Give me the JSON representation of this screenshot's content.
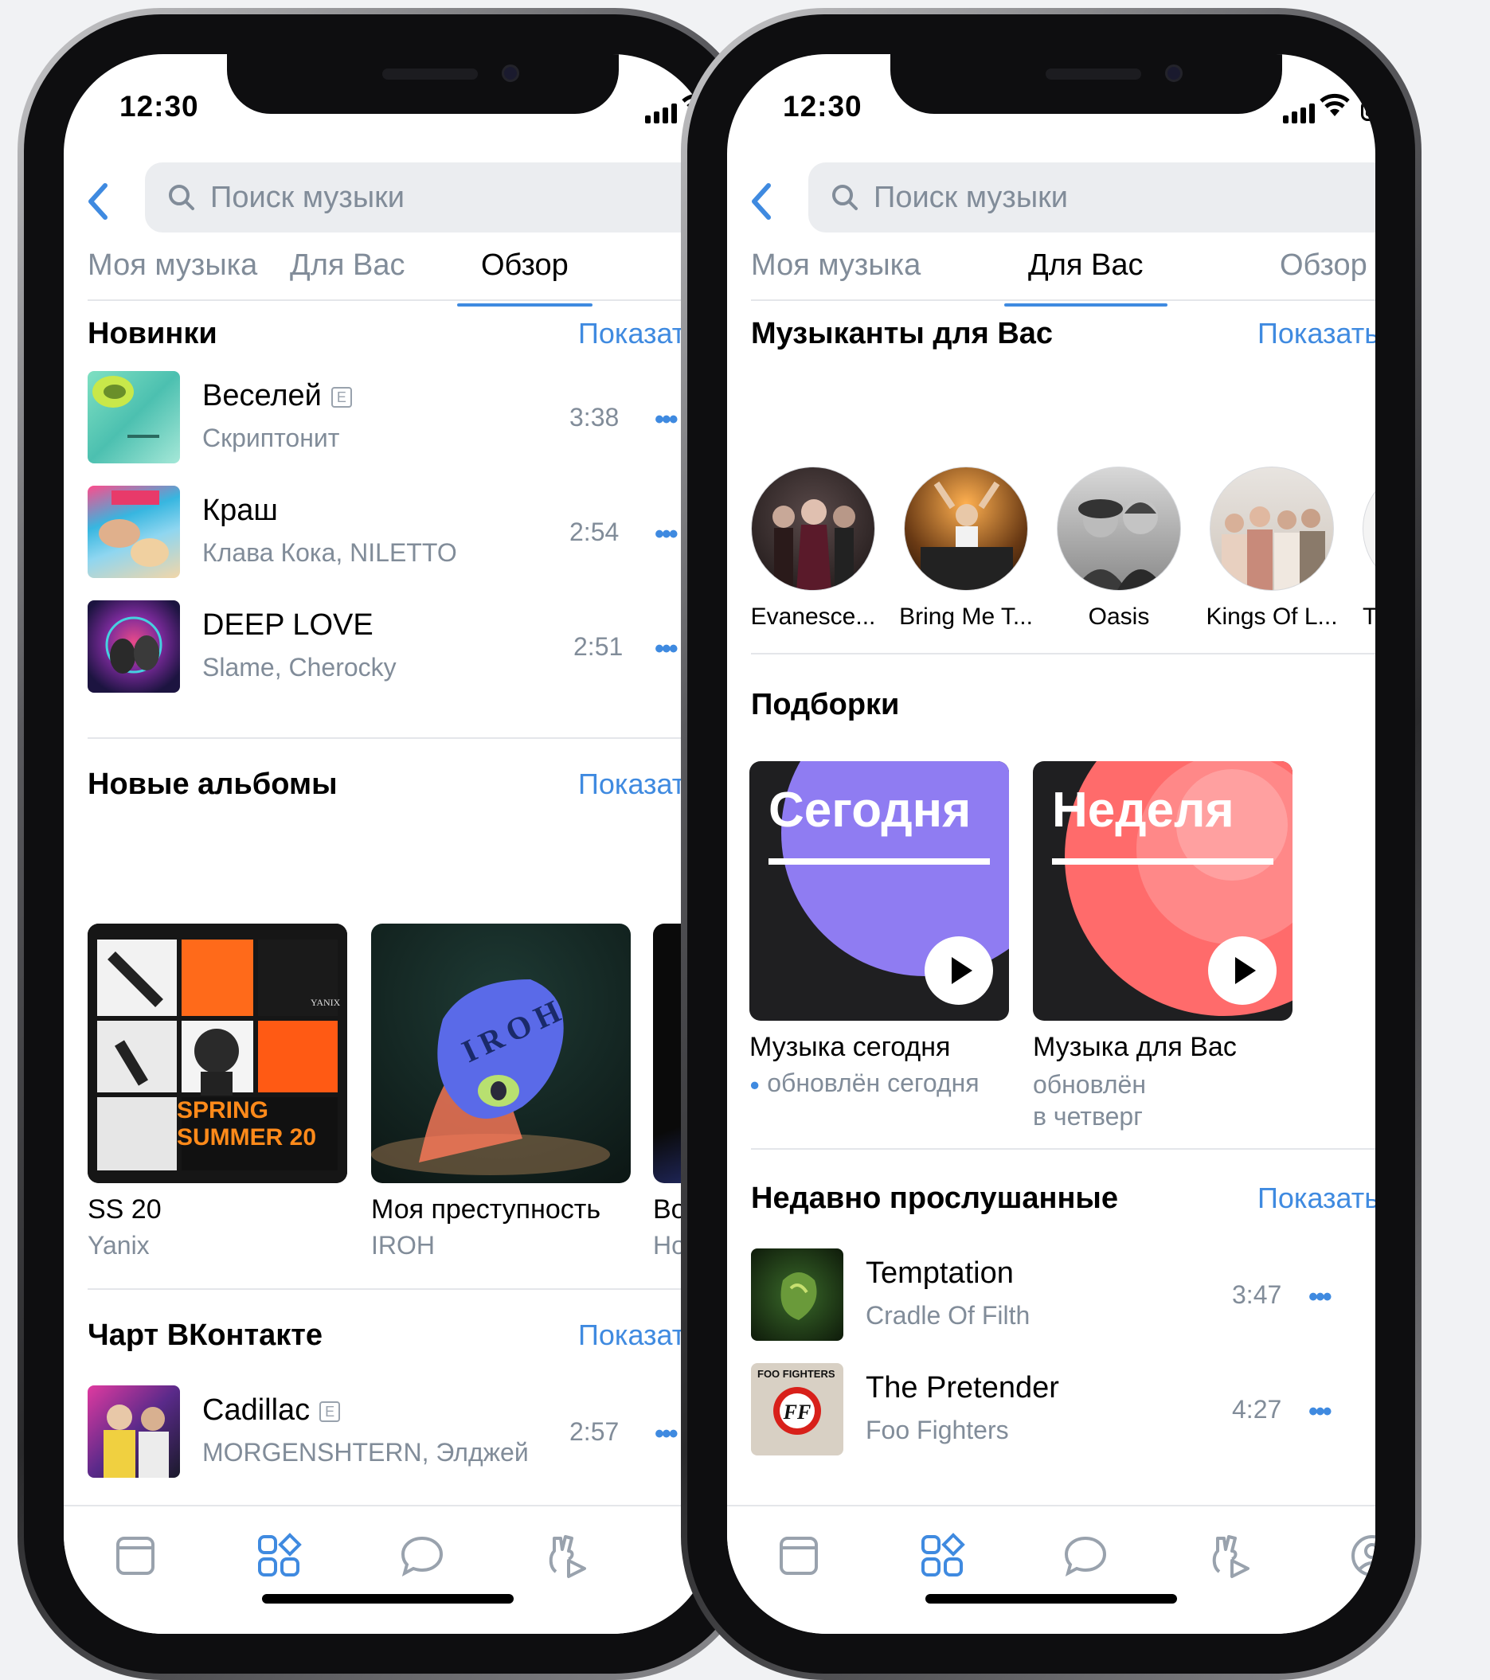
{
  "status_time": "12:30",
  "search_placeholder": "Поиск музыки",
  "tabs": {
    "my_music": "Моя музыка",
    "for_you": "Для Вас",
    "browse": "Обзор"
  },
  "left_screen": {
    "active_tab": "browse",
    "sections": {
      "new_tracks": {
        "title": "Новинки",
        "show_all": "Показать все"
      },
      "new_albums": {
        "title": "Новые альбомы",
        "show_all": "Показать все"
      },
      "chart": {
        "title": "Чарт ВКонтакте",
        "show_all": "Показать все"
      }
    },
    "new_tracks": [
      {
        "title": "Веселей",
        "artist": "Скриптонит",
        "duration": "3:38",
        "explicit": true
      },
      {
        "title": "Краш",
        "artist": "Клава Кока, NILETTO",
        "duration": "2:54",
        "explicit": false
      },
      {
        "title": "DEEP LOVE",
        "artist": "Slame, Cherocky",
        "duration": "2:51",
        "explicit": false
      }
    ],
    "albums": [
      {
        "title": "SS 20",
        "artist": "Yanix",
        "cover_text_1": "SPRING",
        "cover_text_2": "SUMMER 20",
        "cover_text_3": "YANIX"
      },
      {
        "title": "Моя преступность",
        "artist": "IROH",
        "cover_text": "IROH"
      },
      {
        "title": "Во",
        "artist": "Но"
      }
    ],
    "chart_tracks": [
      {
        "title": "Cadillac",
        "artist": "MORGENSHTERN, Элджей",
        "duration": "2:57",
        "explicit": true
      }
    ],
    "explicit_mark": "E"
  },
  "right_screen": {
    "active_tab": "for_you",
    "sections": {
      "artists": {
        "title": "Музыканты для Вас",
        "show_all": "Показать все"
      },
      "playlists": {
        "title": "Подборки"
      },
      "recent": {
        "title": "Недавно прослушанные",
        "show_all": "Показать все"
      }
    },
    "artists": [
      {
        "name": "Evanesce..."
      },
      {
        "name": "Bring Me T..."
      },
      {
        "name": "Oasis"
      },
      {
        "name": "Kings Of L..."
      },
      {
        "name": "Three D"
      }
    ],
    "playlists": [
      {
        "cover_word": "Сегодня",
        "title": "Музыка сегодня",
        "sub1": "обновлён сегодня",
        "sub2": "",
        "accent": "#8f7cf2"
      },
      {
        "cover_word": "Неделя",
        "title": "Музыка для Вас",
        "sub1": "обновлён",
        "sub2": "в четверг",
        "accent": "#ff6b6b"
      }
    ],
    "recent_tracks": [
      {
        "title": "Temptation",
        "artist": "Cradle Of Filth",
        "duration": "3:47"
      },
      {
        "title": "The Pretender",
        "artist": "Foo Fighters",
        "duration": "4:27",
        "cover_text": "FOO FIGHTERS"
      }
    ]
  },
  "colors": {
    "accent": "#3f8ae0",
    "secondary_text": "#818c99",
    "divider": "#e4e6ea"
  },
  "tabbar_icons": [
    "news-icon",
    "services-icon",
    "messages-icon",
    "clips-icon",
    "profile-icon"
  ]
}
